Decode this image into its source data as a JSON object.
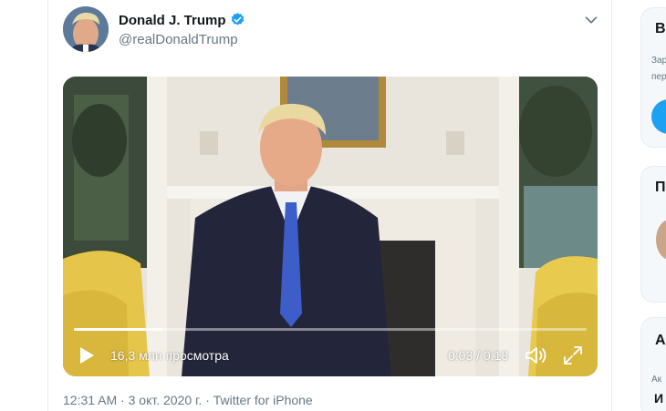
{
  "tweet": {
    "author_name": "Donald J. Trump",
    "author_handle": "@realDonaldTrump",
    "verified": true,
    "video": {
      "views": "16,3 млн просмотра",
      "time": "0:03 / 0:18",
      "progress_fraction": 0.17
    },
    "meta": {
      "time": "12:31 AM",
      "date": "3 окт. 2020 г.",
      "source": "Twitter for iPhone",
      "separator": " · "
    }
  },
  "sidebar": {
    "card1": {
      "title": "В",
      "line1": "Зар",
      "line2": "пер"
    },
    "card2": {
      "title": "П"
    },
    "card3": {
      "title": "А",
      "line1": "Ак",
      "strong": "И"
    }
  },
  "colors": {
    "accent": "#1da1f2",
    "secondary_text": "#657786",
    "primary_text": "#14171a",
    "border": "#e6ecf0"
  },
  "icons": {
    "verified": "verified-badge-icon",
    "caret": "chevron-down-icon",
    "play": "play-icon",
    "volume": "volume-icon",
    "fullscreen": "fullscreen-icon"
  }
}
